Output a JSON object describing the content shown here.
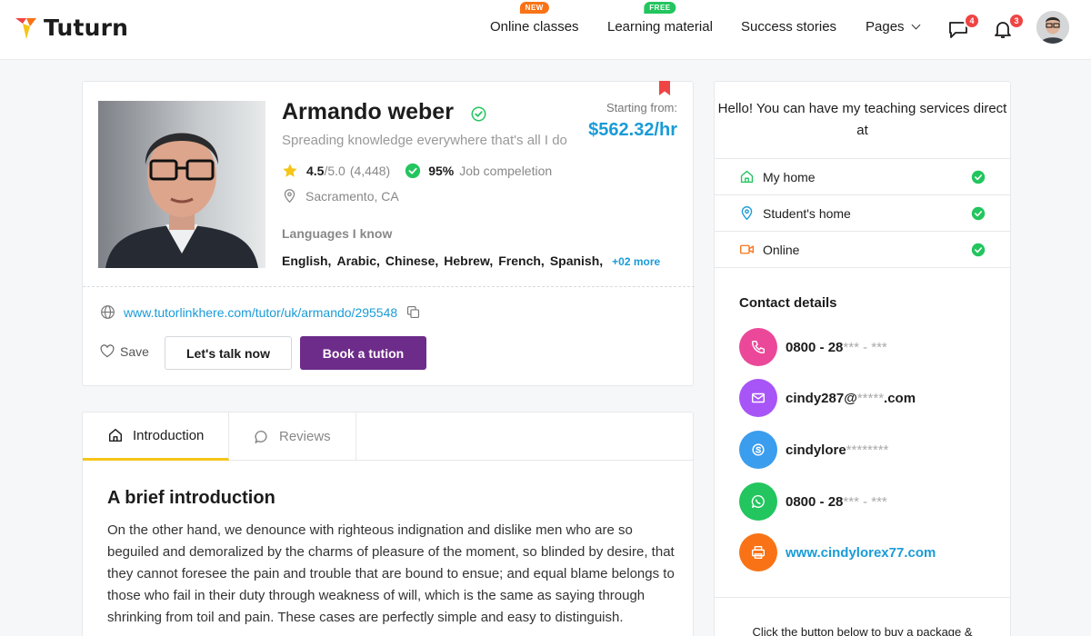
{
  "header": {
    "logo_text": "Tuturn",
    "nav": [
      {
        "label": "Online classes",
        "badge": "NEW",
        "badge_color": "#f97316"
      },
      {
        "label": "Learning material",
        "badge": "FREE",
        "badge_color": "#22c55e"
      },
      {
        "label": "Success stories"
      },
      {
        "label": "Pages"
      }
    ],
    "messages_count": "4",
    "notifications_count": "3"
  },
  "profile": {
    "name": "Armando weber",
    "tagline": "Spreading knowledge everywhere that's all I do",
    "rating": "4.5",
    "rating_max": "/5.0",
    "reviews": "(4,448)",
    "completion": "95%",
    "completion_label": "Job compeletion",
    "location": "Sacramento, CA",
    "languages_title": "Languages I know",
    "languages": [
      "English,",
      "Arabic,",
      "Chinese,",
      "Hebrew,",
      "French,",
      "Spanish,"
    ],
    "languages_more": "+02 more",
    "price_label": "Starting from:",
    "price": "$562.32/hr",
    "profile_link": "www.tutorlinkhere.com/tutor/uk/armando/295548",
    "save_label": "Save",
    "talk_label": "Let's talk now",
    "book_label": "Book a tution"
  },
  "tabs": [
    {
      "label": "Introduction",
      "active": true
    },
    {
      "label": "Reviews",
      "active": false
    }
  ],
  "intro": {
    "title": "A brief introduction",
    "text": "On the other hand, we denounce with righteous indignation and dislike men who are so beguiled and demoralized by the charms of pleasure of the moment, so blinded by desire, that they cannot foresee the pain and trouble that are bound to ensue; and equal blame belongs to those who fail in their duty through weakness of will, which is the same as saying through shrinking from toil and pain. These cases are perfectly simple and easy to distinguish."
  },
  "sidebar": {
    "hello": "Hello! You can have my teaching services direct at",
    "options": [
      {
        "label": "My home",
        "icon": "home-icon",
        "color": "#22c55e"
      },
      {
        "label": "Student's home",
        "icon": "location-pin-icon",
        "color": "#1a9bd7"
      },
      {
        "label": "Online",
        "icon": "video-icon",
        "color": "#f97316"
      }
    ],
    "contact_title": "Contact details",
    "contacts": [
      {
        "icon": "phone-icon",
        "color": "#ec4899",
        "value": "0800 - 28",
        "mask": "*** - ***"
      },
      {
        "icon": "email-icon",
        "color": "#a855f7",
        "value": "cindy287@",
        "mask": "*****",
        "suffix": ".com"
      },
      {
        "icon": "skype-icon",
        "color": "#3b9ded",
        "value": "cindylore",
        "mask": "********"
      },
      {
        "icon": "whatsapp-icon",
        "color": "#22c55e",
        "value": "0800 - 28 ",
        "mask": "*** - ***"
      },
      {
        "icon": "print-icon",
        "color": "#f97316",
        "value": "www.cindylorex77.com"
      }
    ],
    "footer_text": "Click the button below to buy a package &"
  }
}
